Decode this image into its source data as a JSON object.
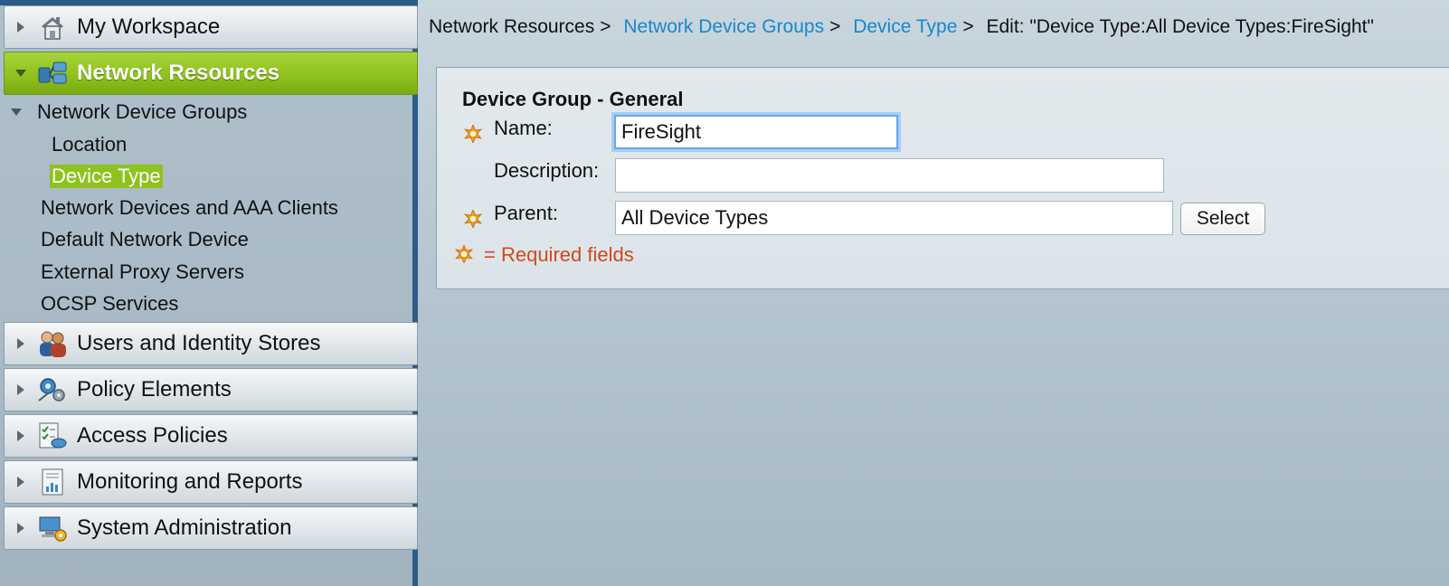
{
  "sidebar": {
    "drawers": [
      {
        "label": "My Workspace",
        "icon": "house-icon"
      },
      {
        "label": "Network Resources",
        "icon": "network-resources-icon"
      },
      {
        "label": "Users and Identity Stores",
        "icon": "users-icon"
      },
      {
        "label": "Policy Elements",
        "icon": "policy-elements-icon"
      },
      {
        "label": "Access Policies",
        "icon": "access-policies-icon"
      },
      {
        "label": "Monitoring and Reports",
        "icon": "reports-icon"
      },
      {
        "label": "System Administration",
        "icon": "system-admin-icon"
      }
    ],
    "tree": {
      "group_label": "Network Device Groups",
      "group_children": [
        "Location",
        "Device Type"
      ],
      "items": [
        "Network Devices and AAA Clients",
        "Default Network Device",
        "External Proxy Servers",
        "OCSP Services"
      ]
    },
    "active_drawer": "Network Resources",
    "selected_item": "Device Type"
  },
  "breadcrumb": {
    "root": "Network Resources",
    "link1": "Network Device Groups",
    "link2": "Device Type",
    "current": "Edit: \"Device Type:All Device Types:FireSight\"",
    "separator": ">"
  },
  "form": {
    "section_title": "Device Group - General",
    "name_label": "Name:",
    "name_value": "FireSight",
    "description_label": "Description:",
    "description_value": "",
    "parent_label": "Parent:",
    "parent_value": "All Device Types",
    "select_button": "Select",
    "required_note": "= Required fields"
  },
  "colors": {
    "accent_green": "#8fc21f",
    "link_blue": "#1a86c9",
    "required_orange": "#d4481c",
    "star_orange": "#f39a1b"
  }
}
